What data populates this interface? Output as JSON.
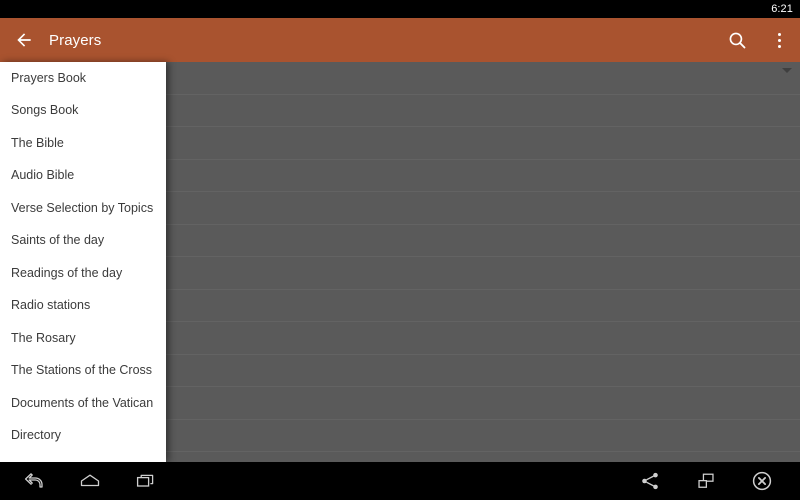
{
  "status_bar": {
    "clock": "6:21"
  },
  "action_bar": {
    "back_icon": "back-arrow-icon",
    "title": "Prayers",
    "search_icon": "search-icon",
    "overflow_icon": "overflow-menu-icon"
  },
  "colors": {
    "action_bar": "#a9532f",
    "status_bar": "#000000",
    "scrim": "#5a5a5a",
    "drawer_background": "#ffffff",
    "drawer_text": "#3b3b3b",
    "nav_bar": "#000000",
    "divider": "#636363"
  },
  "drawer": {
    "items": [
      {
        "label": "Prayers Book"
      },
      {
        "label": "Songs Book"
      },
      {
        "label": "The Bible"
      },
      {
        "label": "Audio Bible"
      },
      {
        "label": "Verse Selection by Topics"
      },
      {
        "label": "Saints of the day"
      },
      {
        "label": "Readings of the day"
      },
      {
        "label": "Radio stations"
      },
      {
        "label": "The Rosary"
      },
      {
        "label": "The Stations of the Cross"
      },
      {
        "label": "Documents of the Vatican"
      },
      {
        "label": "Directory"
      }
    ]
  },
  "content": {
    "row_count": 13,
    "scroll_indicator_icon": "scroll-down-triangle-icon"
  },
  "nav_bar": {
    "back_icon": "nav-back-icon",
    "home_icon": "nav-home-icon",
    "recents_icon": "nav-recents-icon",
    "share_icon": "share-icon",
    "cast_icon": "multi-window-icon",
    "close_icon": "close-circle-icon"
  }
}
